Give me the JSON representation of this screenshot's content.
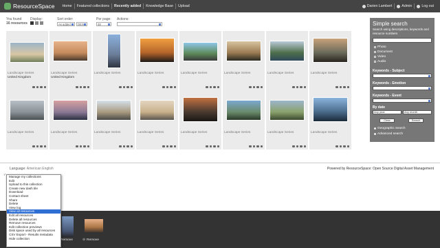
{
  "header": {
    "logo_text": "ResourceSpace",
    "nav": [
      "Home",
      "Featured collections",
      "Recently added",
      "Knowledge Base",
      "Upload"
    ],
    "user": "Darien Lambert",
    "admin": "Admin",
    "logout": "Log out"
  },
  "results": {
    "found_label": "You found",
    "found_count": "16 resources",
    "display_label": "Display:",
    "sort_label": "Sort order:",
    "sort_value": "As added",
    "sort_dir": "DESC",
    "perpage_label": "Per page:",
    "perpage_value": "48",
    "actions_label": "Actions:",
    "actions_value": ""
  },
  "cards": [
    {
      "title": "Landscape Series",
      "sub": "United Kingdom",
      "colors": [
        "#9cb4c8",
        "#d9c7a4",
        "#6f7f5a"
      ]
    },
    {
      "title": "Landscape Series",
      "sub": "United Kingdom",
      "colors": [
        "#e8b28a",
        "#c48a5c",
        "#4a3a2e"
      ]
    },
    {
      "title": "Landscape Series",
      "sub": "",
      "colors": [
        "#8bb0dc",
        "#6b7e9a",
        "#2f3440"
      ]
    },
    {
      "title": "Landscape Series",
      "sub": "",
      "colors": [
        "#f0a040",
        "#b5652a",
        "#1e1a18"
      ]
    },
    {
      "title": "Landscape Series",
      "sub": "",
      "colors": [
        "#8ec6e8",
        "#5d8a5a",
        "#3a3a3a"
      ]
    },
    {
      "title": "Landscape Series",
      "sub": "",
      "colors": [
        "#d8c4a0",
        "#9a7a52",
        "#2a2a22"
      ]
    },
    {
      "title": "Landscape Series",
      "sub": "",
      "colors": [
        "#b9c9d6",
        "#4d6e4a",
        "#2f4a5a"
      ]
    },
    {
      "title": "Landscape Series",
      "sub": "",
      "colors": [
        "#c8a27a",
        "#6a6a5a",
        "#2a2520"
      ]
    },
    {
      "title": "Landscape Series",
      "sub": "",
      "colors": [
        "#b8bec6",
        "#8a9298",
        "#4a4f52"
      ]
    },
    {
      "title": "Landscape Series",
      "sub": "",
      "colors": [
        "#d6a0a0",
        "#8a7894",
        "#2a3040"
      ]
    },
    {
      "title": "Landscape Series",
      "sub": "",
      "colors": [
        "#d6e0ea",
        "#a89a80",
        "#4a4a48"
      ]
    },
    {
      "title": "Landscape Series",
      "sub": "",
      "colors": [
        "#e4d6c2",
        "#c8b08a",
        "#5a5650"
      ]
    },
    {
      "title": "Landscape Series",
      "sub": "",
      "colors": [
        "#c07040",
        "#4a3a30",
        "#1a1614"
      ]
    },
    {
      "title": "Landscape Series",
      "sub": "",
      "colors": [
        "#7aa8d0",
        "#6a8a6a",
        "#2a3a2a"
      ]
    },
    {
      "title": "Landscape Series",
      "sub": "",
      "colors": [
        "#9cb6cc",
        "#8aa06a",
        "#3a4a30"
      ]
    },
    {
      "title": "Landscape Series",
      "sub": "",
      "colors": [
        "#8ab4dc",
        "#4a6a8a",
        "#1a2a3a"
      ]
    }
  ],
  "sidebar": {
    "title": "Simple search",
    "desc": "Search using descriptions, keywords and resource numbers",
    "types": [
      "Photo",
      "Document",
      "Video",
      "Audio"
    ],
    "kw_subject": "Keywords - Subject",
    "kw_emotion": "Keywords - Emotion",
    "kw_event": "Keywords - Event",
    "by_date": "By date",
    "any_year": "Any year",
    "any_month": "Any month",
    "clear": "Clear",
    "search": "Search",
    "geo": "Geographic search",
    "advanced": "Advanced search"
  },
  "footer": {
    "language_label": "Language:",
    "language_value": "American English",
    "powered": "Powered by ResourceSpace: Open Source Digital Asset Management"
  },
  "menu": {
    "items": [
      "Manage my collections",
      "Edit",
      "Upload to this collection",
      "Create new dash tile",
      "Download",
      "Contact sheet",
      "Share",
      "Delete",
      "View log",
      "View all resources",
      "Edit all resources",
      "Delete all resources",
      "Remove resources",
      "Edit collection previews",
      "Disk space used by all resources",
      "CSV Export - Results metadata",
      "Hide collection"
    ],
    "highlighted_index": 9
  },
  "collection": {
    "remove1": "Remove",
    "remove2": "Remove"
  }
}
